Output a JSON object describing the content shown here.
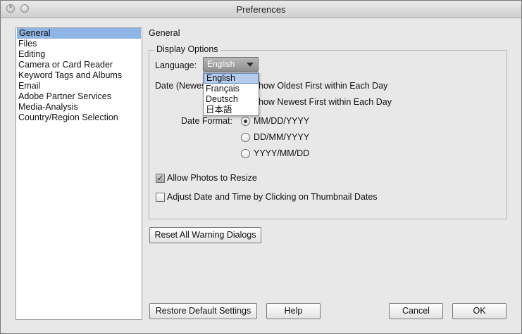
{
  "window": {
    "title": "Preferences"
  },
  "sidebar": {
    "items": [
      {
        "label": "General",
        "selected": true
      },
      {
        "label": "Files"
      },
      {
        "label": "Editing"
      },
      {
        "label": "Camera or Card Reader"
      },
      {
        "label": "Keyword Tags and Albums"
      },
      {
        "label": "Email"
      },
      {
        "label": "Adobe Partner Services"
      },
      {
        "label": "Media-Analysis"
      },
      {
        "label": "Country/Region Selection"
      }
    ]
  },
  "main": {
    "section_title": "General",
    "display_options": {
      "group_label": "Display Options",
      "language_label": "Language:",
      "language_value": "English",
      "language_options": [
        "English",
        "Français",
        "Deutsch",
        "日本語"
      ],
      "date_label_partial": "Date (Newes",
      "date_order_options": [
        "how Oldest First within Each Day",
        "how Newest First within Each Day"
      ],
      "date_format_label": "Date Format:",
      "date_formats": [
        {
          "label": "MM/DD/YYYY",
          "checked": true
        },
        {
          "label": "DD/MM/YYYY",
          "checked": false
        },
        {
          "label": "YYYY/MM/DD",
          "checked": false
        }
      ],
      "allow_resize": {
        "label": "Allow Photos to Resize",
        "checked": true
      },
      "adjust_date": {
        "label": "Adjust Date and Time by Clicking on Thumbnail Dates",
        "checked": false
      }
    },
    "reset_warnings_label": "Reset All Warning Dialogs"
  },
  "footer": {
    "restore_label": "Restore Default Settings",
    "help_label": "Help",
    "cancel_label": "Cancel",
    "ok_label": "OK"
  },
  "colors": {
    "selection": "#8fb4e6",
    "menu_highlight": "#b6ccec"
  }
}
